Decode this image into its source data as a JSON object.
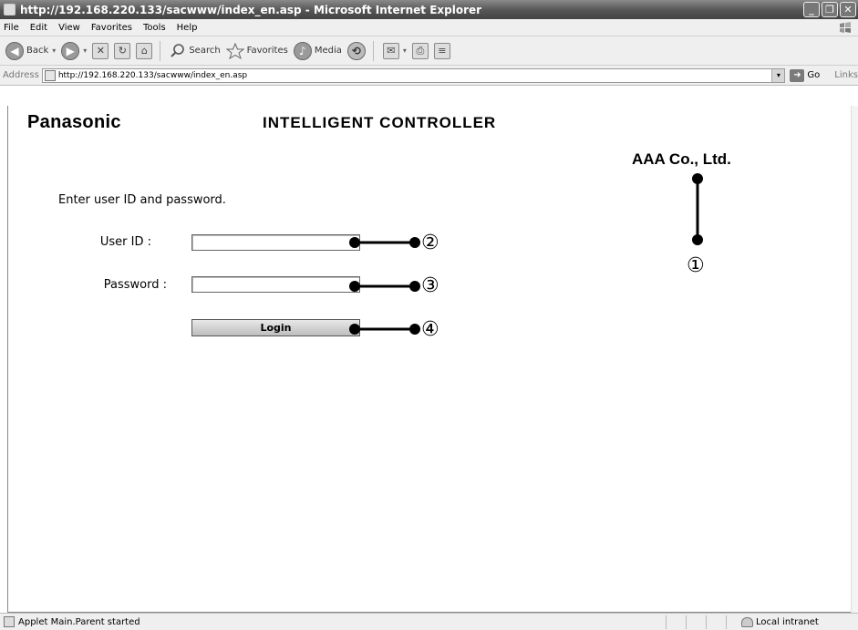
{
  "window": {
    "title": "http://192.168.220.133/sacwww/index_en.asp - Microsoft Internet Explorer",
    "controls": {
      "minimize": "_",
      "restore": "❐",
      "close": "✕"
    }
  },
  "menubar": {
    "items": [
      "File",
      "Edit",
      "View",
      "Favorites",
      "Tools",
      "Help"
    ]
  },
  "toolbar": {
    "back_label": "Back",
    "search_label": "Search",
    "favorites_label": "Favorites",
    "media_label": "Media"
  },
  "addressbar": {
    "label": "Address",
    "url": "http://192.168.220.133/sacwww/index_en.asp",
    "go_label": "Go",
    "links_label": "Links"
  },
  "page": {
    "brand": "Panasonic",
    "title": "INTELLIGENT CONTROLLER",
    "company": "AAA Co., Ltd.",
    "instruction": "Enter user ID and password.",
    "user_id_label": "User ID :",
    "user_id_value": "",
    "password_label": "Password :",
    "password_value": "",
    "login_label": "Login"
  },
  "callouts": [
    "①",
    "②",
    "③",
    "④"
  ],
  "statusbar": {
    "message": "Applet Main.Parent started",
    "zone": "Local intranet"
  },
  "icons": [
    "ie-page-icon",
    "back-icon",
    "forward-icon",
    "stop-icon",
    "refresh-icon",
    "home-icon",
    "search-icon",
    "favorites-star-icon",
    "media-icon",
    "history-icon",
    "mail-icon",
    "print-icon",
    "edit-icon",
    "go-arrow-icon",
    "windows-flag-icon",
    "local-intranet-icon"
  ]
}
